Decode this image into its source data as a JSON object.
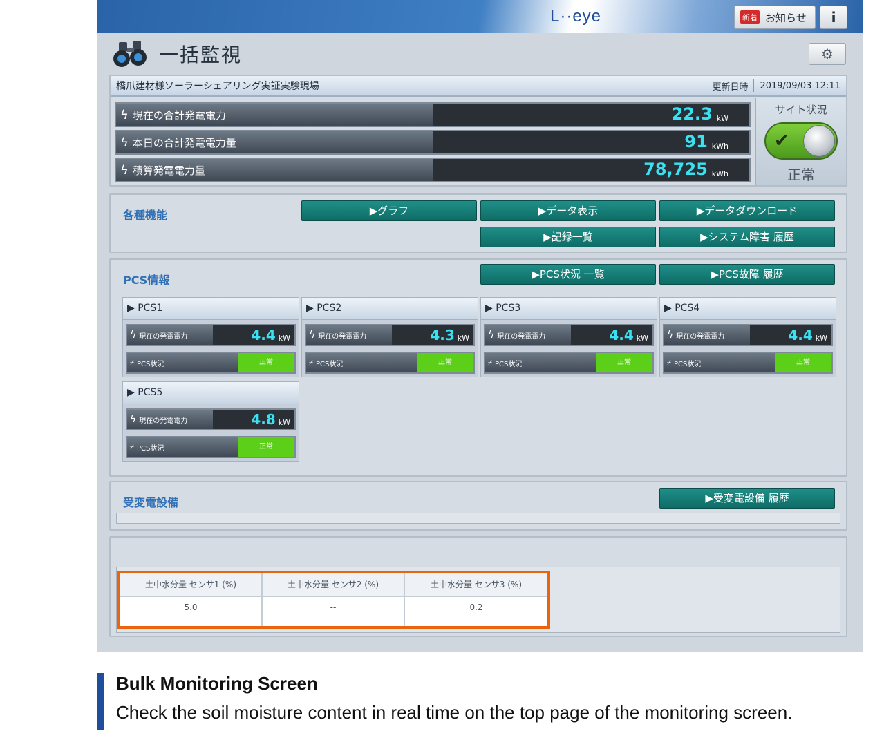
{
  "header": {
    "logo": "L··eye",
    "notice_badge": "新着",
    "notice_label": "お知らせ",
    "info_label": "i"
  },
  "page": {
    "title": "一括監視",
    "settings_icon": "gear-icon"
  },
  "site": {
    "name": "橋爪建材様ソーラーシェアリング実証実験現場",
    "updated_label": "更新日時",
    "updated_value": "2019/09/03  12:11",
    "meters": [
      {
        "label": "現在の合計発電電力",
        "value": "22.3",
        "unit": "kW"
      },
      {
        "label": "本日の合計発電電力量",
        "value": "91",
        "unit": "kWh"
      },
      {
        "label": "積算発電電力量",
        "value": "78,725",
        "unit": "kWh"
      }
    ],
    "status_title": "サイト状況",
    "status_value": "正常"
  },
  "functions": {
    "title": "各種機能",
    "buttons": [
      "▶グラフ",
      "▶データ表示",
      "▶データダウンロード",
      "▶記録一覧",
      "▶システム障害 履歴"
    ]
  },
  "pcs": {
    "title": "PCS情報",
    "buttons": [
      "▶PCS状況 一覧",
      "▶PCS故障 履歴"
    ],
    "power_label": "現在の発電電力",
    "status_label": "PCS状況",
    "units": [
      {
        "name": "▶ PCS1",
        "value": "4.4",
        "unit": "kW",
        "status": "正常"
      },
      {
        "name": "▶ PCS2",
        "value": "4.3",
        "unit": "kW",
        "status": "正常"
      },
      {
        "name": "▶ PCS3",
        "value": "4.4",
        "unit": "kW",
        "status": "正常"
      },
      {
        "name": "▶ PCS4",
        "value": "4.4",
        "unit": "kW",
        "status": "正常"
      },
      {
        "name": "▶ PCS5",
        "value": "4.8",
        "unit": "kW",
        "status": "正常"
      }
    ]
  },
  "receiving": {
    "title": "受変電設備",
    "button": "▶受変電設備 履歴"
  },
  "soil": {
    "headers": [
      "土中水分量  センサ1 (%)",
      "土中水分量  センサ2 (%)",
      "土中水分量  センサ3 (%)"
    ],
    "values": [
      "5.0",
      "--",
      "0.2"
    ]
  },
  "caption": {
    "title": "Bulk Monitoring Screen",
    "text": "Check the soil moisture content in real time on the top page of the monitoring screen."
  }
}
